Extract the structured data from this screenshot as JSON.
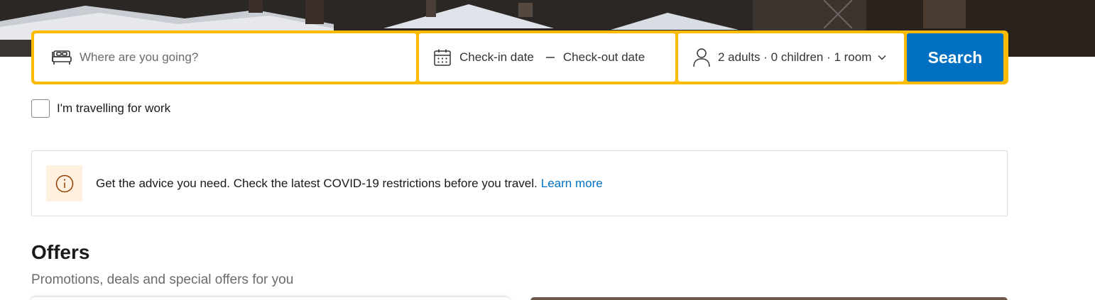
{
  "search": {
    "destination_placeholder": "Where are you going?",
    "check_in_label": "Check-in date",
    "check_out_label": "Check-out date",
    "guests_label": "2 adults · 0 children · 1 room",
    "search_button_label": "Search"
  },
  "work_trip": {
    "label": "I'm travelling for work",
    "checked": false
  },
  "notice": {
    "message": "Get the advice you need. Check the latest COVID-19 restrictions before you travel.",
    "link_text": "Learn more"
  },
  "offers": {
    "title": "Offers",
    "subtitle": "Promotions, deals and special offers for you"
  },
  "icons": {
    "destination": "bed-icon",
    "dates": "calendar-icon",
    "guests": "person-icon",
    "guests_dropdown": "chevron-down-icon",
    "notice": "info-icon"
  },
  "colors": {
    "search_border": "#febb02",
    "primary_blue": "#0071c2",
    "notice_badge_bg": "#fff0e0",
    "notice_icon": "#923e01"
  }
}
